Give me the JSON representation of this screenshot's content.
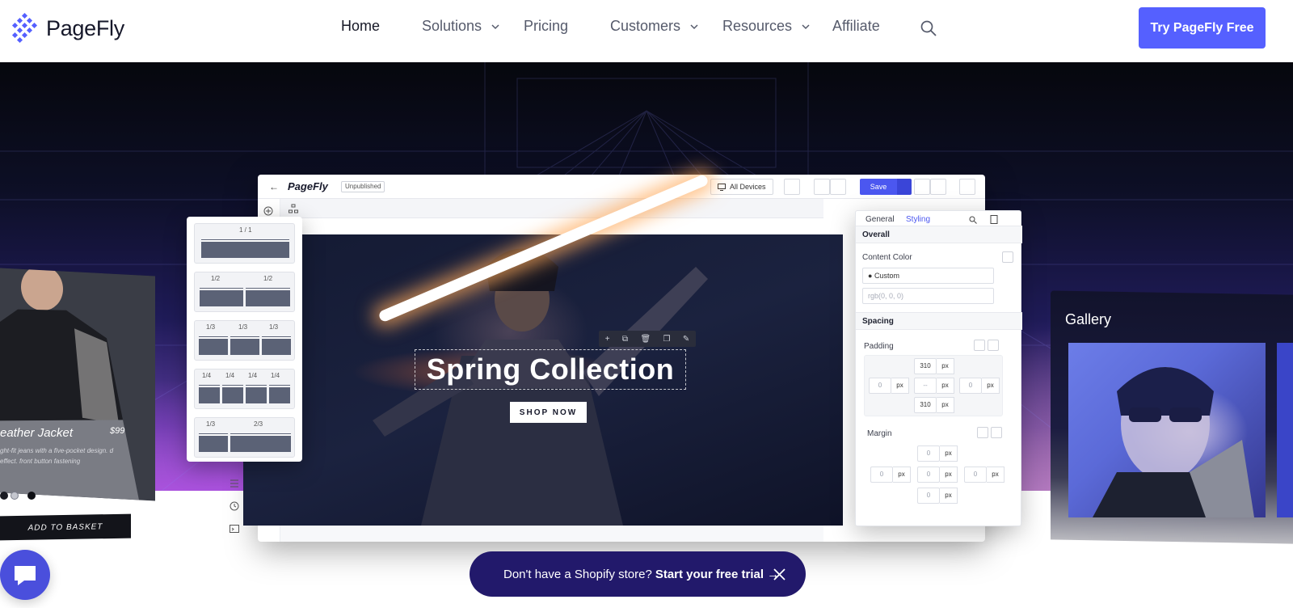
{
  "nav": {
    "logo_text": "PageFly",
    "items": [
      {
        "label": "Home",
        "active": true,
        "dropdown": false
      },
      {
        "label": "Solutions",
        "active": false,
        "dropdown": true
      },
      {
        "label": "Pricing",
        "active": false,
        "dropdown": false
      },
      {
        "label": "Customers",
        "active": false,
        "dropdown": true
      },
      {
        "label": "Resources",
        "active": false,
        "dropdown": true
      },
      {
        "label": "Affiliate",
        "active": false,
        "dropdown": false
      }
    ],
    "search_icon": "search-icon",
    "cta_label": "Try PageFly Free"
  },
  "editor": {
    "brand": "PageFly",
    "status_badge": "Unpublished",
    "devices_label": "All Devices",
    "save_label": "Save",
    "canvas": {
      "headline": "Spring Collection",
      "button_label": "SHOP NOW"
    }
  },
  "styling_panel": {
    "tabs": [
      "General",
      "Styling"
    ],
    "active_tab": "Styling",
    "sections": {
      "overall": "Overall",
      "spacing": "Spacing"
    },
    "content_color_label": "Content Color",
    "color_select_value": "Custom",
    "color_input_placeholder": "rgb(0, 0, 0)",
    "padding": {
      "label": "Padding",
      "top": "310",
      "left": "0",
      "center": "--",
      "right": "0",
      "bottom": "310",
      "unit": "px"
    },
    "margin": {
      "label": "Margin",
      "top": "0",
      "left": "0",
      "center": "0",
      "right": "0",
      "bottom": "0",
      "unit": "px"
    }
  },
  "layout_picker": {
    "options": [
      {
        "labels": [
          "1 / 1"
        ]
      },
      {
        "labels": [
          "1/2",
          "1/2"
        ]
      },
      {
        "labels": [
          "1/3",
          "1/3",
          "1/3"
        ]
      },
      {
        "labels": [
          "1/4",
          "1/4",
          "1/4",
          "1/4"
        ]
      },
      {
        "labels": [
          "1/3",
          "2/3"
        ]
      }
    ]
  },
  "product_card": {
    "title": "eather Jacket",
    "price": "$99",
    "description": "ght-fit jeans with a five-pocket design. d effect. front button fastening",
    "add_to_basket": "ADD TO BASKET"
  },
  "gallery_card": {
    "title": "Gallery"
  },
  "banner": {
    "text": "Don't have a Shopify store?",
    "link": "Start your free trial →"
  },
  "colors": {
    "primary": "#5560ff",
    "banner_bg": "#22196b",
    "hero_dark": "#06070d",
    "hero_purple": "#9c69c8"
  }
}
